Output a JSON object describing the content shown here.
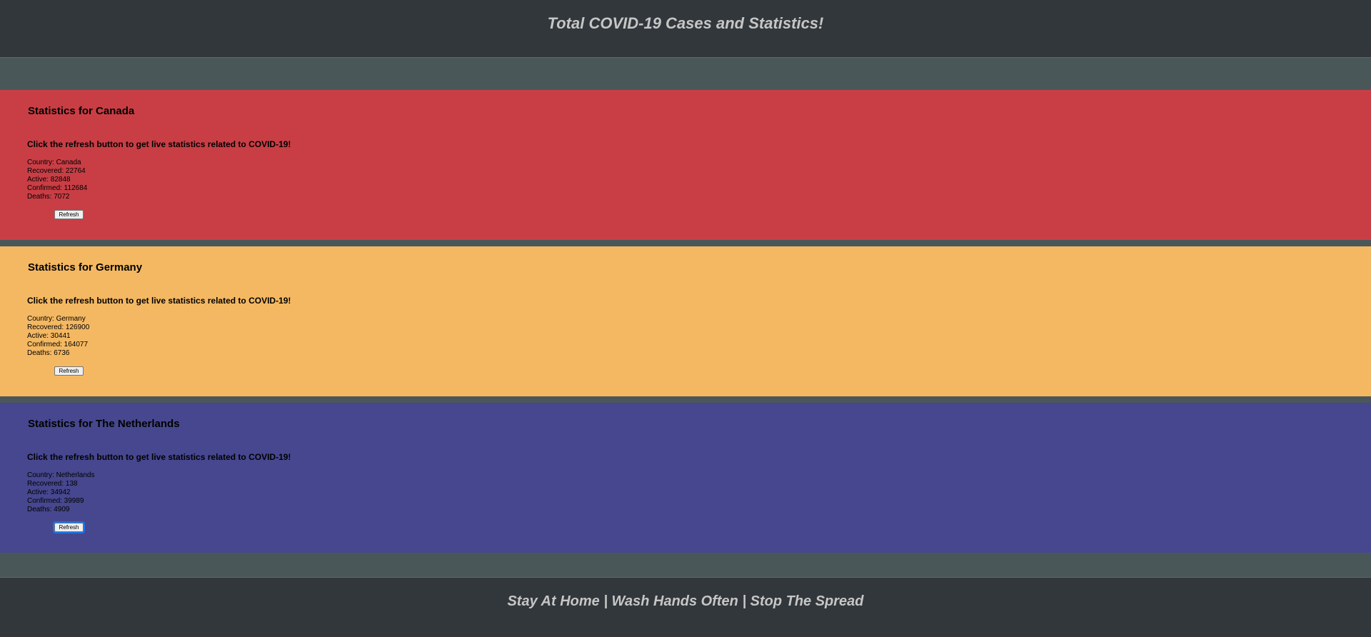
{
  "header": {
    "title": "Total COVID-19 Cases and Statistics!"
  },
  "colors": {
    "canada": "#c93e45",
    "germany": "#f4b862",
    "netherlands": "#46478e",
    "dark": "#32373b",
    "gap": "#4a5759"
  },
  "cards": [
    {
      "title": "Statistics for Canada",
      "prompt": "Click the refresh button to get live statistics related to COVID-19!",
      "country": "Country: Canada",
      "recovered": "Recovered: 22764",
      "active": "Active: 82848",
      "confirmed": "Confirmed: 112684",
      "deaths": "Deaths: 7072",
      "button": "Refresh"
    },
    {
      "title": "Statistics for Germany",
      "prompt": "Click the refresh button to get live statistics related to COVID-19!",
      "country": "Country: Germany",
      "recovered": "Recovered: 126900",
      "active": "Active: 30441",
      "confirmed": "Confirmed: 164077",
      "deaths": "Deaths: 6736",
      "button": "Refresh"
    },
    {
      "title": "Statistics for The Netherlands",
      "prompt": "Click the refresh button to get live statistics related to COVID-19!",
      "country": "Country: Netherlands",
      "recovered": "Recovered: 138",
      "active": "Active: 34942",
      "confirmed": "Confirmed: 39989",
      "deaths": "Deaths: 4909",
      "button": "Refresh"
    }
  ],
  "footer": {
    "text": "Stay At Home | Wash Hands Often | Stop The Spread"
  }
}
